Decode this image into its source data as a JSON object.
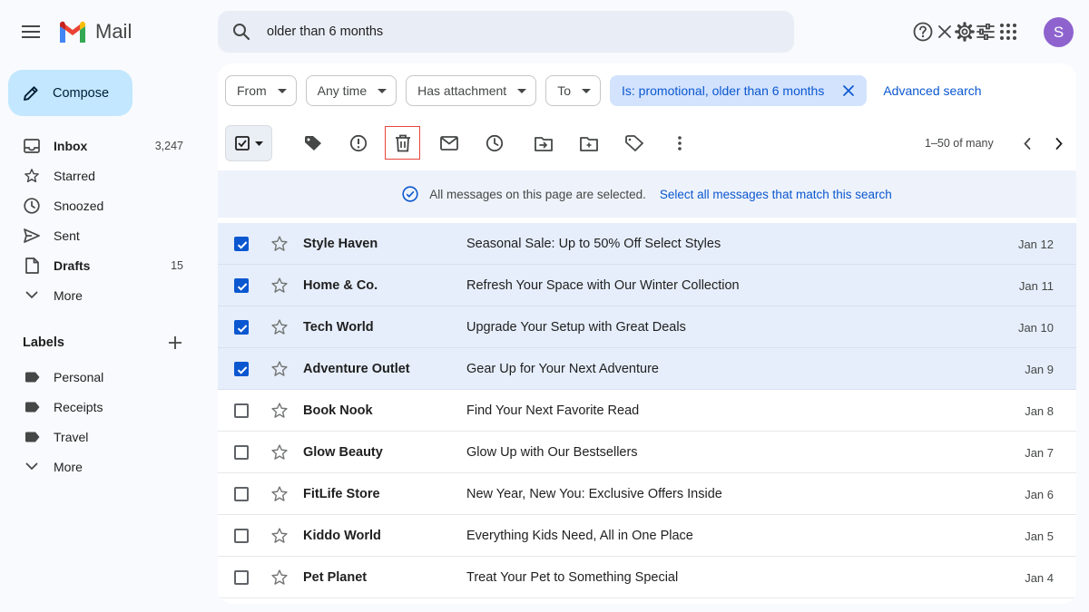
{
  "app": {
    "name": "Mail",
    "avatar_initial": "S",
    "avatar_color": "#8e63ce"
  },
  "search": {
    "value": "older than 6 months"
  },
  "compose": {
    "label": "Compose",
    "color": "#c2e7ff"
  },
  "nav": [
    {
      "label": "Inbox",
      "count": "3,247",
      "icon": "inbox-icon",
      "bold": true
    },
    {
      "label": "Starred",
      "count": "",
      "icon": "star-icon",
      "bold": false
    },
    {
      "label": "Snoozed",
      "count": "",
      "icon": "clock-icon",
      "bold": false
    },
    {
      "label": "Sent",
      "count": "",
      "icon": "send-icon",
      "bold": false
    },
    {
      "label": "Drafts",
      "count": "15",
      "icon": "draft-icon",
      "bold": true
    },
    {
      "label": "More",
      "count": "",
      "icon": "chevron-down-icon",
      "bold": false
    }
  ],
  "labels": {
    "heading": "Labels",
    "items": [
      "Personal",
      "Receipts",
      "Travel"
    ],
    "more": "More"
  },
  "filters": {
    "chips": [
      "From",
      "Any time",
      "Has attachment",
      "To"
    ],
    "active": "Is: promotional, older than 6 months",
    "advanced": "Advanced search"
  },
  "toolbar": {
    "pagination": "1–50 of many"
  },
  "banner": {
    "text": "All messages on this page are selected.",
    "link": "Select all messages that match this search"
  },
  "emails": [
    {
      "sender": "Style Haven",
      "subject": "Seasonal Sale: Up to 50% Off Select Styles",
      "date": "Jan 12",
      "selected": true
    },
    {
      "sender": "Home & Co.",
      "subject": "Refresh Your Space with Our Winter Collection",
      "date": "Jan 11",
      "selected": true
    },
    {
      "sender": "Tech World",
      "subject": "Upgrade Your Setup with Great Deals",
      "date": "Jan 10",
      "selected": true
    },
    {
      "sender": "Adventure Outlet",
      "subject": "Gear Up for Your Next Adventure",
      "date": "Jan 9",
      "selected": true
    },
    {
      "sender": "Book Nook",
      "subject": "Find Your Next Favorite Read",
      "date": "Jan 8",
      "selected": false
    },
    {
      "sender": "Glow Beauty",
      "subject": "Glow Up with Our Bestsellers",
      "date": "Jan 7",
      "selected": false
    },
    {
      "sender": "FitLife Store",
      "subject": "New Year, New You: Exclusive Offers Inside",
      "date": "Jan 6",
      "selected": false
    },
    {
      "sender": "Kiddo World",
      "subject": "Everything Kids Need, All in One Place",
      "date": "Jan 5",
      "selected": false
    },
    {
      "sender": "Pet Planet",
      "subject": "Treat Your Pet to Something Special",
      "date": "Jan 4",
      "selected": false
    }
  ],
  "colors": {
    "accent": "#0b57d0",
    "highlight": "#e8443a",
    "selected_row": "#e6eefb"
  }
}
